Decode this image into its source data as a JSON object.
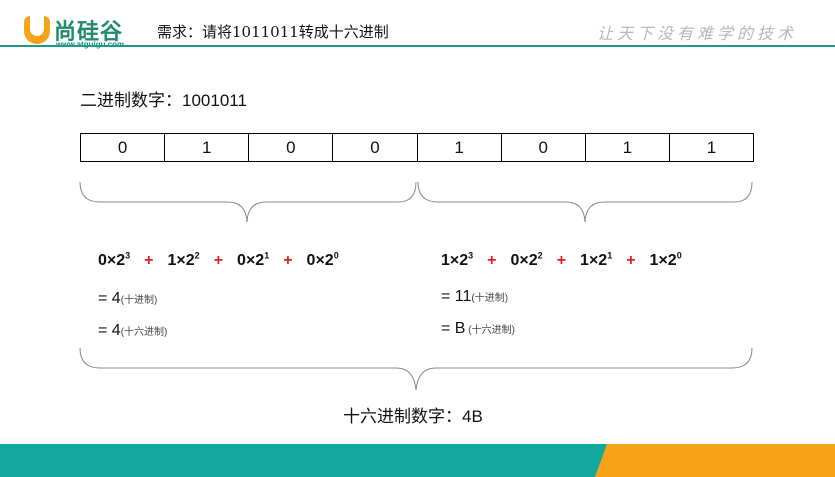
{
  "header": {
    "logo_cn": "尚硅谷",
    "logo_url": "www.atguigu.com",
    "title": "需求：请将1011011转成十六进制",
    "slogan": "让天下没有难学的技术"
  },
  "binary_label": "二进制数字：1001011",
  "bits": [
    "0",
    "1",
    "0",
    "0",
    "1",
    "0",
    "1",
    "1"
  ],
  "left_group": {
    "terms": [
      {
        "coef": "0",
        "base": "2",
        "exp": "3"
      },
      {
        "coef": "1",
        "base": "2",
        "exp": "2"
      },
      {
        "coef": "0",
        "base": "2",
        "exp": "1"
      },
      {
        "coef": "0",
        "base": "2",
        "exp": "0"
      }
    ],
    "operator": "+",
    "result_decimal": "= 4",
    "decimal_note": "(十进制)",
    "result_hex": "= 4",
    "hex_note": "(十六进制)"
  },
  "right_group": {
    "terms": [
      {
        "coef": "1",
        "base": "2",
        "exp": "3"
      },
      {
        "coef": "0",
        "base": "2",
        "exp": "2"
      },
      {
        "coef": "1",
        "base": "2",
        "exp": "1"
      },
      {
        "coef": "1",
        "base": "2",
        "exp": "0"
      }
    ],
    "operator": "+",
    "result_decimal": "= 11",
    "decimal_note": "(十进制)",
    "result_hex": "= B",
    "hex_note": " (十六进制)"
  },
  "hex_label": "十六进制数字：4B",
  "colors": {
    "teal": "#13a89e",
    "orange": "#f6a31a",
    "plus_red": "#e02020"
  }
}
